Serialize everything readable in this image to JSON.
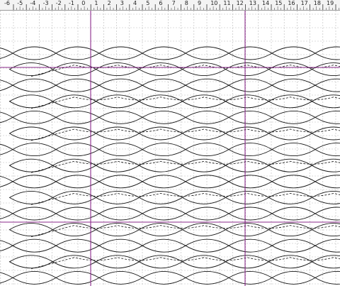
{
  "ruler": {
    "labels": [
      "-6",
      "-5",
      "-4",
      "-3",
      "-2",
      "-1",
      "0",
      "1",
      "2",
      "3",
      "4",
      "5",
      "6",
      "7",
      "8",
      "9",
      "10",
      "11",
      "12",
      "13",
      "14",
      "15",
      "16",
      "17",
      "18",
      "19"
    ]
  },
  "colors": {
    "grid": "#b9b9b9",
    "guide": "#8b2a8b",
    "stroke": "#141414",
    "ruler_bg": "#f3f3f3"
  },
  "quilt": {
    "pattern": "interlocking-arc-chain",
    "line_style": [
      "solid",
      "dashed"
    ]
  }
}
